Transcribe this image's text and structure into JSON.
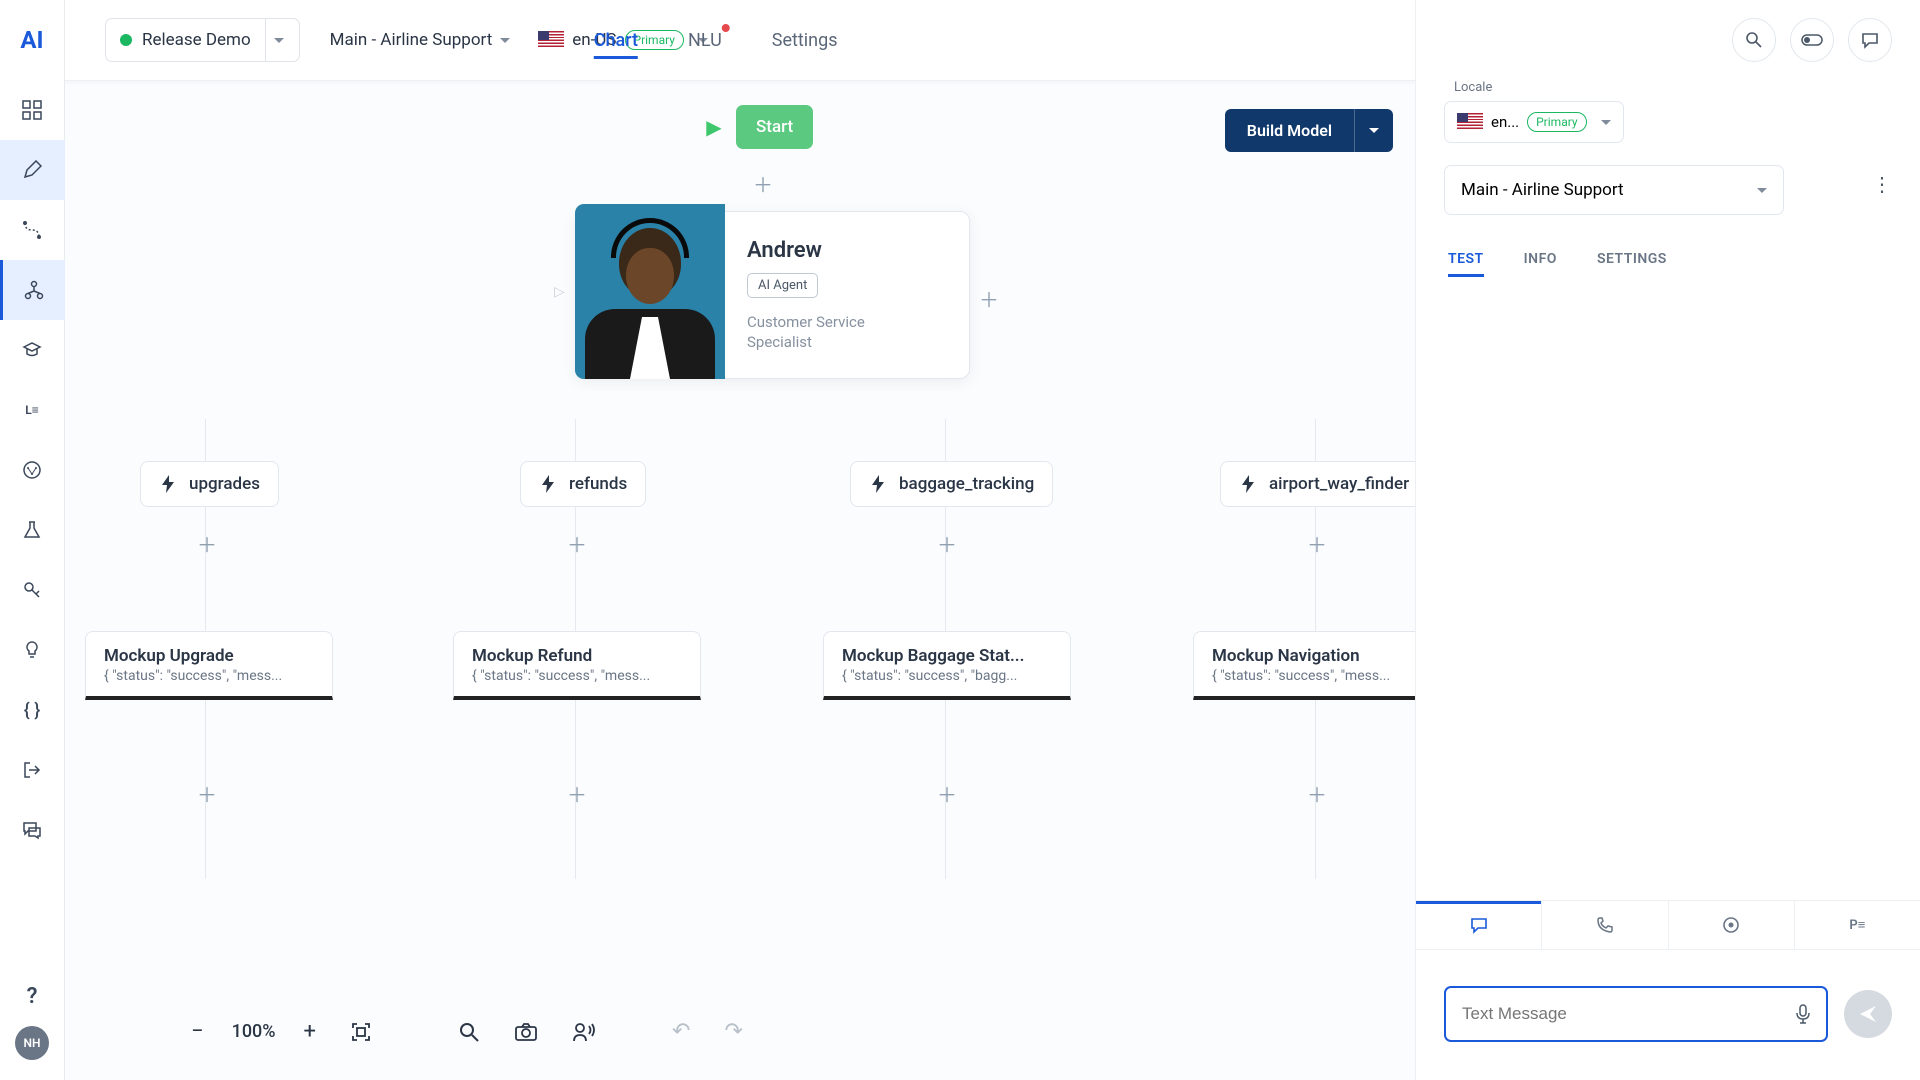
{
  "logo": "AI",
  "topbar": {
    "release": "Release Demo",
    "flow": "Main - Airline Support",
    "locale": "en-US",
    "locale_badge": "Primary"
  },
  "tabs": {
    "chart": "Chart",
    "nlu": "NLU",
    "settings": "Settings"
  },
  "build_model": "Build Model",
  "start": "Start",
  "agent": {
    "name": "Andrew",
    "badge": "AI Agent",
    "role": "Customer Service Specialist"
  },
  "intents": [
    "upgrades",
    "refunds",
    "baggage_tracking",
    "airport_way_finder"
  ],
  "mockups": [
    {
      "title": "Mockup Upgrade",
      "sub": "{ \"status\": \"success\", \"mess..."
    },
    {
      "title": "Mockup Refund",
      "sub": "{ \"status\": \"success\", \"mess..."
    },
    {
      "title": "Mockup Baggage Stat...",
      "sub": "{ \"status\": \"success\", \"bagg..."
    },
    {
      "title": "Mockup Navigation",
      "sub": "{ \"status\": \"success\", \"mess..."
    }
  ],
  "zoom": "100%",
  "rp": {
    "locale_label": "Locale",
    "locale_val": "en...",
    "locale_badge": "Primary",
    "flow_val": "Main - Airline Support",
    "tabs": {
      "test": "TEST",
      "info": "INFO",
      "settings": "SETTINGS"
    },
    "input_placeholder": "Text Message"
  },
  "avatar": "NH"
}
